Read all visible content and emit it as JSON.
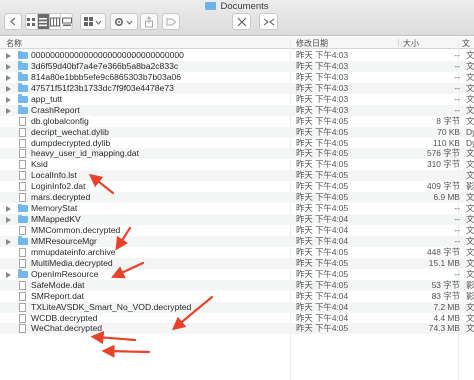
{
  "window": {
    "title": "Documents"
  },
  "toolbar": {
    "view_modes": [
      "icon",
      "list",
      "column",
      "gallery"
    ]
  },
  "columns": {
    "name": "名称",
    "date": "修改日期",
    "size": "大小",
    "kind": "文"
  },
  "rows": [
    {
      "type": "folder",
      "name": "00000000000000000000000000000000",
      "date": "昨天 下午4:03",
      "size": "--",
      "kind": "文"
    },
    {
      "type": "folder",
      "name": "3d6f59d40bf7a4e7e366b5a8ba2c833c",
      "date": "昨天 下午4:03",
      "size": "--",
      "kind": "文"
    },
    {
      "type": "folder",
      "name": "814a80e1bbb5efe9c6865303b7b03a06",
      "date": "昨天 下午4:03",
      "size": "--",
      "kind": "文"
    },
    {
      "type": "folder",
      "name": "47571f51f23b1733dc7f9f03e4478e73",
      "date": "昨天 下午4:03",
      "size": "--",
      "kind": "文"
    },
    {
      "type": "folder",
      "name": "app_tutt",
      "date": "昨天 下午4:03",
      "size": "--",
      "kind": "文"
    },
    {
      "type": "folder",
      "name": "CrashReport",
      "date": "昨天 下午4:03",
      "size": "--",
      "kind": "文"
    },
    {
      "type": "file",
      "name": "db.globalconfig",
      "date": "昨天 下午4:05",
      "size": "8 字节",
      "kind": "文"
    },
    {
      "type": "file",
      "name": "decript_wechat.dylib",
      "date": "昨天 下午4:05",
      "size": "70 KB",
      "kind": "Dy"
    },
    {
      "type": "file",
      "name": "dumpdecrypted.dylib",
      "date": "昨天 下午4:05",
      "size": "110 KB",
      "kind": "Dy"
    },
    {
      "type": "file",
      "name": "heavy_user_id_mapping.dat",
      "date": "昨天 下午4:05",
      "size": "576 字节",
      "kind": "文"
    },
    {
      "type": "file",
      "name": "Ksid",
      "date": "昨天 下午4:05",
      "size": "310 字节",
      "kind": "文"
    },
    {
      "type": "file",
      "name": "LocalInfo.lst",
      "date": "昨天 下午4:05",
      "size": "",
      "kind": "文"
    },
    {
      "type": "file",
      "name": "LoginInfo2.dat",
      "date": "昨天 下午4:05",
      "size": "409 字节",
      "kind": "影"
    },
    {
      "type": "file",
      "name": "mars.decrypted",
      "date": "昨天 下午4:05",
      "size": "6.9 MB",
      "kind": "文"
    },
    {
      "type": "folder",
      "name": "MemoryStat",
      "date": "昨天 下午4:05",
      "size": "--",
      "kind": "文"
    },
    {
      "type": "folder",
      "name": "MMappedKV",
      "date": "昨天 下午4:04",
      "size": "--",
      "kind": "文"
    },
    {
      "type": "file",
      "name": "MMCommon.decrypted",
      "date": "昨天 下午4:04",
      "size": "--",
      "kind": "文"
    },
    {
      "type": "folder",
      "name": "MMResourceMgr",
      "date": "昨天 下午4:04",
      "size": "--",
      "kind": "文"
    },
    {
      "type": "file",
      "name": "mmupdateinfo.archive",
      "date": "昨天 下午4:05",
      "size": "448 字节",
      "kind": "文"
    },
    {
      "type": "file",
      "name": "MultiMedia.decrypted",
      "date": "昨天 下午4:05",
      "size": "15.1 MB",
      "kind": "文"
    },
    {
      "type": "folder",
      "name": "OpenImResource",
      "date": "昨天 下午4:05",
      "size": "--",
      "kind": "文"
    },
    {
      "type": "file",
      "name": "SafeMode.dat",
      "date": "昨天 下午4:05",
      "size": "53 字节",
      "kind": "影"
    },
    {
      "type": "file",
      "name": "SMReport.dat",
      "date": "昨天 下午4:04",
      "size": "83 字节",
      "kind": "影"
    },
    {
      "type": "file",
      "name": "TXLiteAVSDK_Smart_No_VOD.decrypted",
      "date": "昨天 下午4:04",
      "size": "7.2 MB",
      "kind": "文"
    },
    {
      "type": "file",
      "name": "WCDB.decrypted",
      "date": "昨天 下午4:04",
      "size": "4.4 MB",
      "kind": "文"
    },
    {
      "type": "file",
      "name": "WeChat.decrypted",
      "date": "昨天 下午4:05",
      "size": "74.3 MB",
      "kind": "文"
    }
  ],
  "colors": {
    "folder": "#72b7ee",
    "annotation_arrow": "#e8432a",
    "selected_view": "#6b6b6b"
  }
}
